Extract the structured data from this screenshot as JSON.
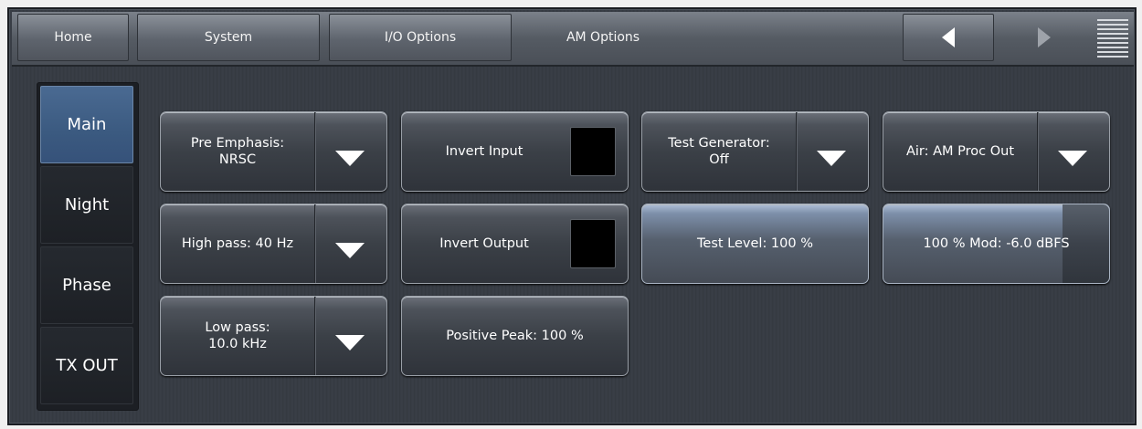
{
  "nav": {
    "home": "Home",
    "system": "System",
    "io_options": "I/O Options",
    "am_options": "AM Options"
  },
  "side_tabs": [
    "Main",
    "Night",
    "Phase",
    "TX OUT"
  ],
  "active_side_tab": "Main",
  "controls": {
    "pre_emphasis": "Pre Emphasis:\nNRSC",
    "invert_input": "Invert Input",
    "test_generator": "Test Generator:\nOff",
    "air": "Air: AM Proc Out",
    "high_pass": "High pass: 40 Hz",
    "invert_output": "Invert Output",
    "test_level": "Test Level: 100 %",
    "mod_100": "100 % Mod: -6.0 dBFS",
    "low_pass": "Low pass:\n10.0 kHz",
    "positive_peak": "Positive Peak: 100 %"
  },
  "levels": {
    "test_level_fraction": 1.0,
    "mod_100_fraction": 0.795
  },
  "colors": {
    "active_tab": "#3b5a80",
    "toggle_off": "#000000"
  }
}
